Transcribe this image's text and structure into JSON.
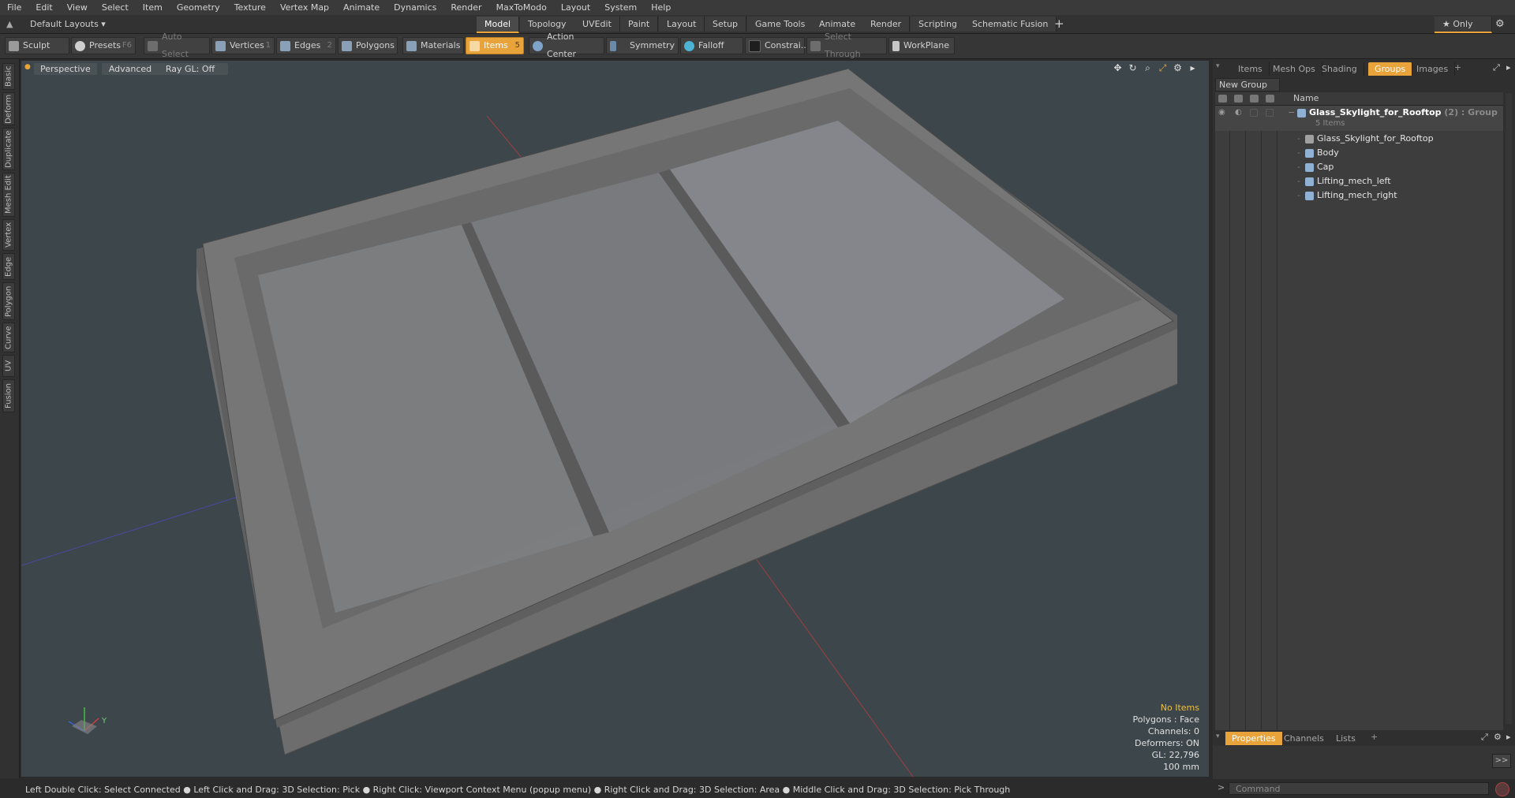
{
  "menu": [
    "File",
    "Edit",
    "View",
    "Select",
    "Item",
    "Geometry",
    "Texture",
    "Vertex Map",
    "Animate",
    "Dynamics",
    "Render",
    "MaxToModo",
    "Layout",
    "System",
    "Help"
  ],
  "layout_selector": "Default Layouts ▾",
  "layout_tabs": [
    "Model",
    "Topology",
    "UVEdit",
    "Paint",
    "Layout",
    "Setup",
    "Game Tools",
    "Animate",
    "Render",
    "Scripting",
    "Schematic Fusion"
  ],
  "active_layout_tab": "Model",
  "add_tab": "+",
  "only_label": "★ Only",
  "toolbar": {
    "sculpt": "Sculpt",
    "presets": "Presets",
    "presets_key": "F6",
    "auto_select": "Auto Select",
    "vertices": "Vertices",
    "vertices_key": "1",
    "edges": "Edges",
    "edges_key": "2",
    "polygons": "Polygons",
    "materials": "Materials",
    "items": "Items",
    "items_key": "5",
    "action_center": "Action Center",
    "symmetry": "Symmetry",
    "falloff": "Falloff",
    "constraints": "Constrai...",
    "select_through": "Select Through",
    "workplane": "WorkPlane"
  },
  "side_tabs": [
    "Basic",
    "Deform",
    "Duplicate",
    "Mesh Edit",
    "Vertex",
    "Edge",
    "Polygon",
    "Curve",
    "UV",
    "Fusion"
  ],
  "viewport": {
    "perspective": "Perspective",
    "advanced": "Advanced",
    "raygl": "Ray GL: Off",
    "axis_y": "Y",
    "stats": {
      "no_items": "No Items",
      "polygons": "Polygons : Face",
      "channels": "Channels: 0",
      "deformers": "Deformers: ON",
      "gl": "GL: 22,796",
      "size": "100 mm"
    }
  },
  "right_tabs": [
    "Items",
    "Mesh Ops",
    "Shading",
    "Groups",
    "Images"
  ],
  "active_right_tab": "Groups",
  "new_group": "New Group",
  "tree_header": "Name",
  "tree": {
    "group_name": "Glass_Skylight_for_Rooftop",
    "group_suffix": " (2) : Group",
    "group_count": "5 Items",
    "children": [
      "Glass_Skylight_for_Rooftop",
      "Body",
      "Cap",
      "Lifting_mech_left",
      "Lifting_mech_right"
    ]
  },
  "bottom_tabs": [
    "Properties",
    "Channels",
    "Lists"
  ],
  "active_bottom_tab": "Properties",
  "expand_btn": ">>",
  "command_placeholder": "Command",
  "status": "Left Double Click: Select Connected ● Left Click and Drag: 3D Selection: Pick ● Right Click: Viewport Context Menu (popup menu) ● Right Click and Drag: 3D Selection: Area ● Middle Click and Drag: 3D Selection: Pick Through",
  "colors": {
    "accent": "#e8a33a",
    "viewport_bg": "#3c464b",
    "panel_bg": "#2f2f2f"
  }
}
